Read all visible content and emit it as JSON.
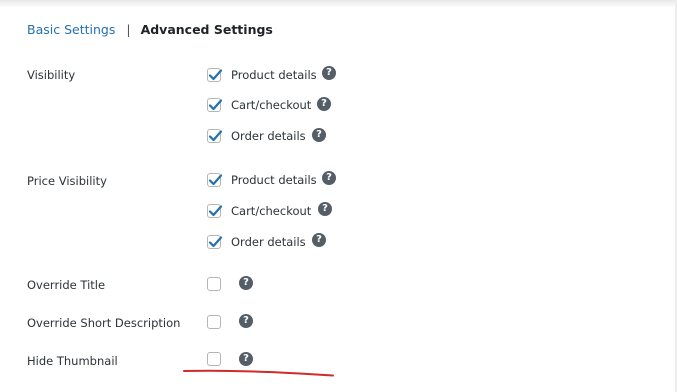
{
  "tabs": {
    "basic": "Basic Settings",
    "separator": "|",
    "advanced": "Advanced Settings"
  },
  "help_glyph": "?",
  "sections": {
    "visibility": {
      "label": "Visibility",
      "options": [
        {
          "label": "Product details",
          "checked": true
        },
        {
          "label": "Cart/checkout",
          "checked": true
        },
        {
          "label": "Order details",
          "checked": true
        }
      ]
    },
    "price_visibility": {
      "label": "Price Visibility",
      "options": [
        {
          "label": "Product details",
          "checked": true
        },
        {
          "label": "Cart/checkout",
          "checked": true
        },
        {
          "label": "Order details",
          "checked": true
        }
      ]
    },
    "override_title": {
      "label": "Override Title",
      "checked": false
    },
    "override_short_description": {
      "label": "Override Short Description",
      "checked": false
    },
    "hide_thumbnail": {
      "label": "Hide Thumbnail",
      "checked": false
    }
  },
  "colors": {
    "link": "#2271b1",
    "checkmark": "#2271b1",
    "help_icon": "#555d66",
    "annotation_underline": "#d02b2b"
  }
}
